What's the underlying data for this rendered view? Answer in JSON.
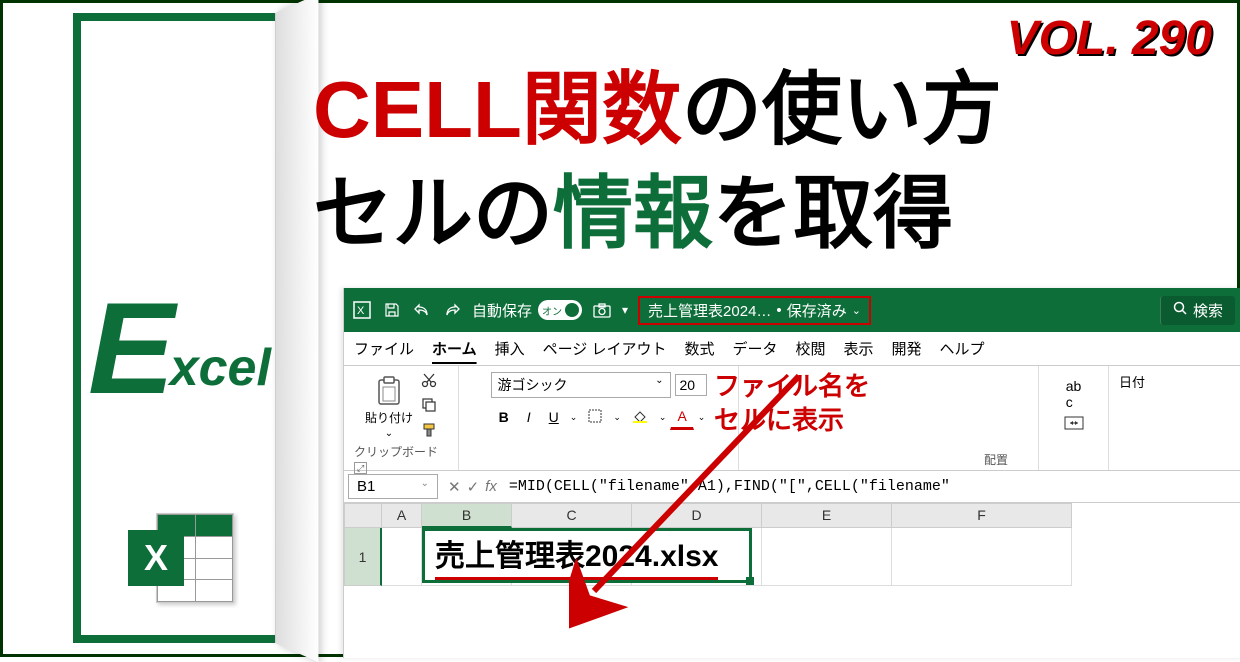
{
  "volume_label": "VOL. 290",
  "logo": {
    "big_letter": "E",
    "rest": "xcel",
    "icon_letter": "X"
  },
  "title": {
    "line1_red": "CELL関数",
    "line1_black": "の使い方",
    "line2_black1": "セルの",
    "line2_green": "情報",
    "line2_black2": "を取得"
  },
  "annotation": {
    "line1": "ファイル名を",
    "line2": "セルに表示"
  },
  "titlebar": {
    "autosave_label": "自動保存",
    "autosave_on": "オン",
    "filename": "売上管理表2024…",
    "saved_status": "保存済み",
    "search_label": "検索"
  },
  "menu": {
    "file": "ファイル",
    "home": "ホーム",
    "insert": "挿入",
    "page_layout": "ページ レイアウト",
    "formulas": "数式",
    "data": "データ",
    "review": "校閲",
    "view": "表示",
    "developer": "開発",
    "help": "ヘルプ"
  },
  "ribbon": {
    "paste_label": "貼り付け",
    "clipboard_label": "クリップボード",
    "font_name": "游ゴシック",
    "font_size": "20",
    "alignment_label": "配置",
    "date_label": "日付"
  },
  "formula_bar": {
    "cell_ref": "B1",
    "formula": "=MID(CELL(\"filename\",A1),FIND(\"[\",CELL(\"filename\""
  },
  "grid": {
    "columns": [
      "A",
      "B",
      "C",
      "D",
      "E",
      "F"
    ],
    "row1_label": "1",
    "b1_value": "売上管理表2024.xlsx"
  }
}
